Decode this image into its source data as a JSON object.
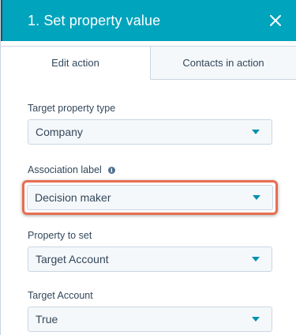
{
  "panel": {
    "title": "1. Set property value",
    "close_icon": "close-icon"
  },
  "tabs": [
    {
      "label": "Edit action",
      "active": true
    },
    {
      "label": "Contacts in action",
      "active": false
    }
  ],
  "fields": {
    "target_property_type": {
      "label": "Target property type",
      "value": "Company"
    },
    "association_label": {
      "label": "Association label",
      "value": "Decision maker",
      "info_icon": "info-icon"
    },
    "property_to_set": {
      "label": "Property to set",
      "value": "Target Account"
    },
    "target_account": {
      "label": "Target Account",
      "value": "True"
    }
  },
  "colors": {
    "header": "#00a4bd",
    "highlight": "#e66e50",
    "caret": "#0091ae"
  }
}
